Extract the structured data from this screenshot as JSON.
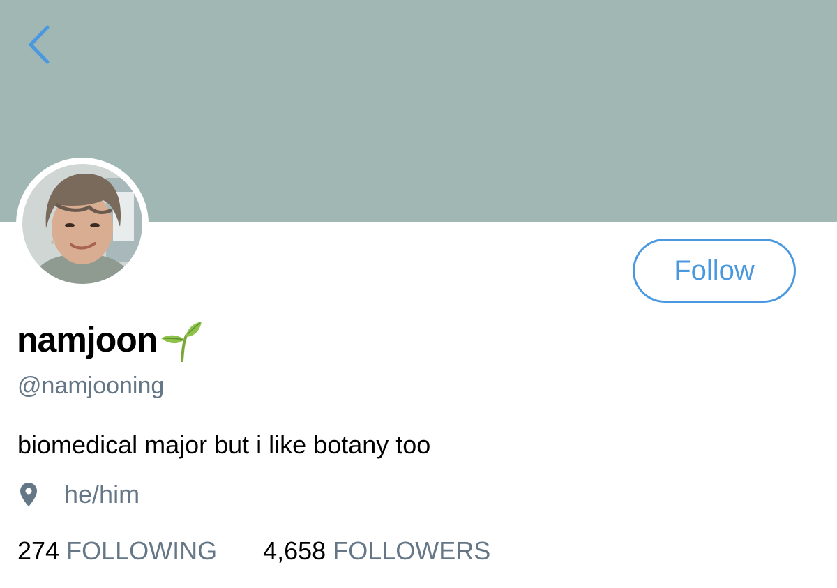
{
  "profile": {
    "display_name": "namjoon",
    "name_emoji_icon": "seedling-icon",
    "handle": "@namjooning",
    "bio": "biomedical major but i like botany too",
    "location_icon": "location-pin-icon",
    "location": "he/him",
    "avatar_icon": "profile-photo"
  },
  "header": {
    "back_icon": "chevron-left-icon",
    "banner_color": "#a0b7b4"
  },
  "actions": {
    "follow_label": "Follow",
    "accent_color": "#4a99e0"
  },
  "stats": {
    "following_count": "274",
    "following_label": "FOLLOWING",
    "followers_count": "4,658",
    "followers_label": "FOLLOWERS"
  }
}
